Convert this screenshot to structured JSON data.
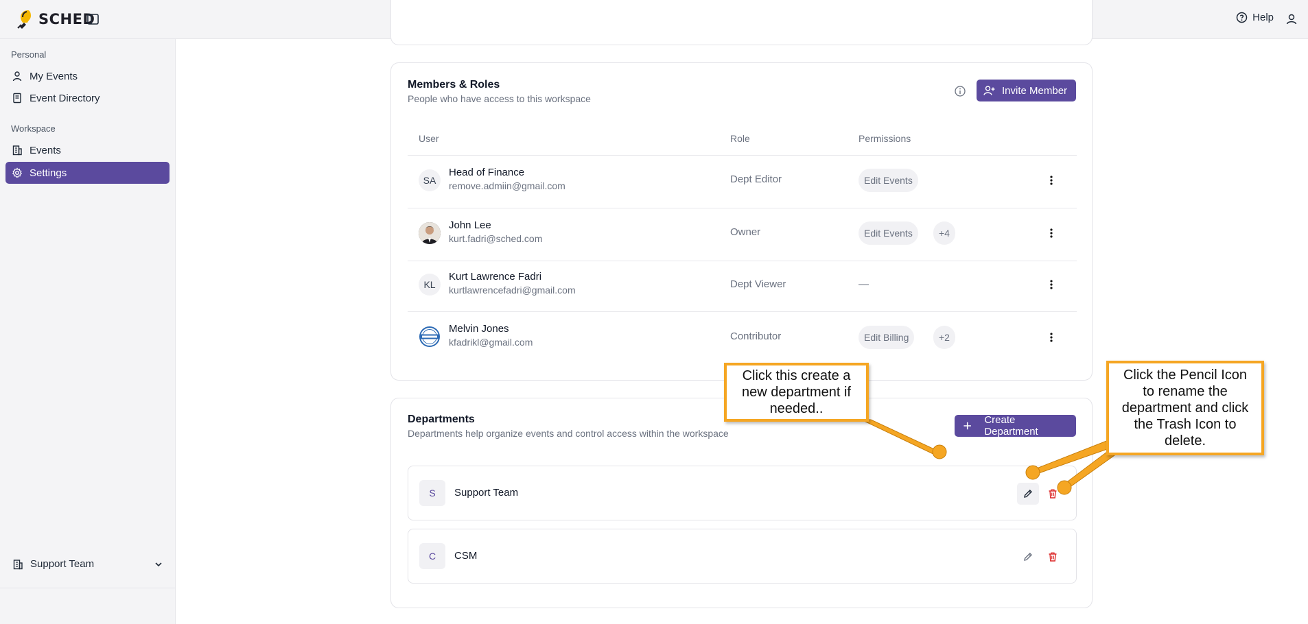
{
  "app": {
    "brand": "SCHED"
  },
  "topbar": {
    "help_label": "Help"
  },
  "sidebar": {
    "personal_heading": "Personal",
    "workspace_heading": "Workspace",
    "items": [
      {
        "label": "My Events"
      },
      {
        "label": "Event Directory"
      },
      {
        "label": "Events"
      },
      {
        "label": "Settings"
      }
    ],
    "workspace_switcher": "Support Team"
  },
  "members": {
    "title": "Members & Roles",
    "subtitle": "People who have access to this workspace",
    "invite_label": "Invite Member",
    "columns": [
      "User",
      "Role",
      "Permissions"
    ],
    "rows": [
      {
        "initials": "SA",
        "name": "Head of Finance",
        "email": "remove.admiin@gmail.com",
        "role": "Dept Editor",
        "permissions": [
          "Edit Events"
        ],
        "more": ""
      },
      {
        "initials": "",
        "name": "John Lee",
        "email": "kurt.fadri@sched.com",
        "role": "Owner",
        "permissions": [
          "Edit Events"
        ],
        "more": "+4"
      },
      {
        "initials": "KL",
        "name": "Kurt Lawrence Fadri",
        "email": "kurtlawrencefadri@gmail.com",
        "role": "Dept Viewer",
        "permissions": [],
        "none": "—",
        "more": ""
      },
      {
        "initials": "",
        "name": "Melvin Jones",
        "email": "kfadrikl@gmail.com",
        "role": "Contributor",
        "permissions": [
          "Edit Billing"
        ],
        "more": "+2"
      }
    ]
  },
  "departments": {
    "title": "Departments",
    "subtitle": "Departments help organize events and control access within the workspace",
    "create_label": "Create Department",
    "items": [
      {
        "badge": "S",
        "name": "Support Team"
      },
      {
        "badge": "C",
        "name": "CSM"
      }
    ]
  },
  "callouts": {
    "create": "Click this create a new department if needed..",
    "edit": "Click the Pencil Icon to rename the department and click the Trash Icon to delete."
  },
  "colors": {
    "accent": "#5b4a9e",
    "callout_border": "#f5a623",
    "danger": "#dc2626"
  }
}
